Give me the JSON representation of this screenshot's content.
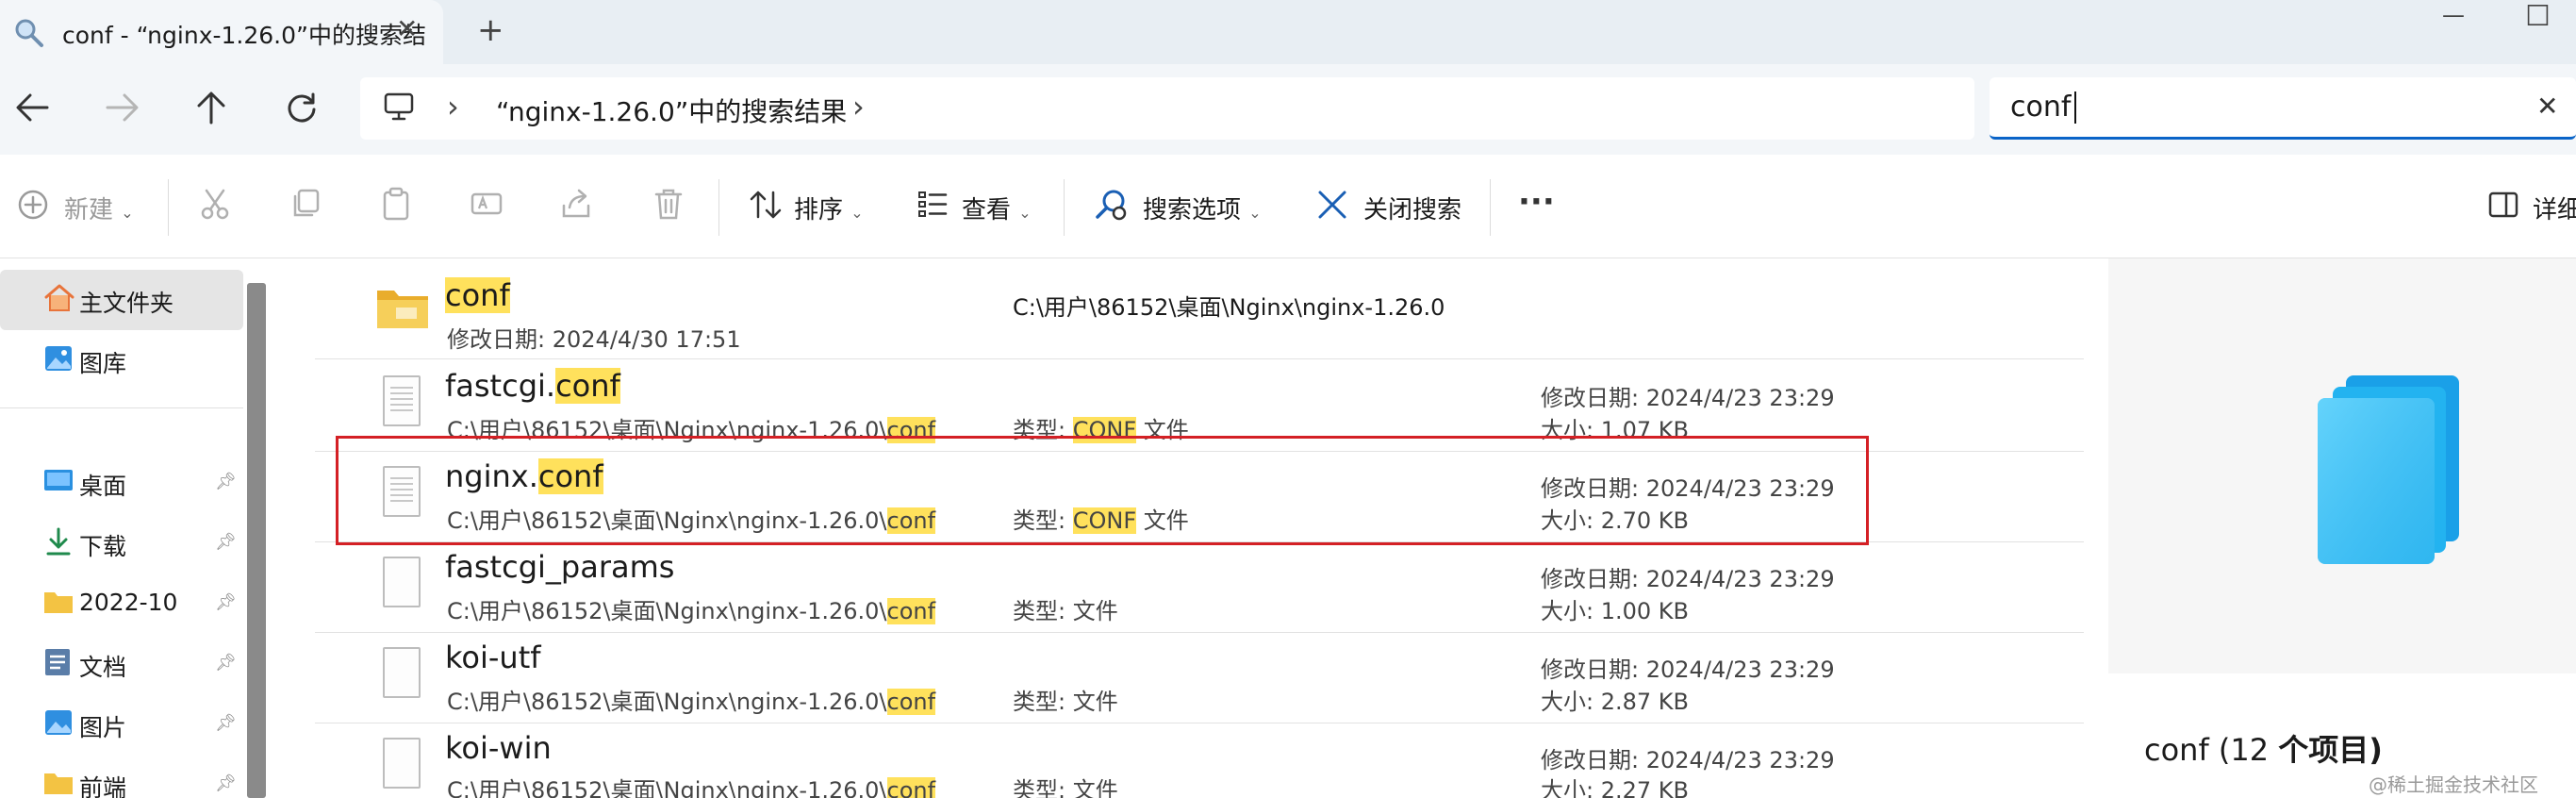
{
  "window": {
    "tab_title": "conf - “nginx-1.26.0”中的搜索结",
    "close_tab": "✕",
    "new_tab": "+",
    "minimize": "—",
    "maximize": "☐"
  },
  "nav": {
    "breadcrumb_sep1": "›",
    "breadcrumb": "“nginx-1.26.0”中的搜索结果",
    "breadcrumb_sep2": "›"
  },
  "search": {
    "value": "conf",
    "clear": "✕"
  },
  "toolbar": {
    "new_label": "新建",
    "sort_label": "排序",
    "view_label": "查看",
    "search_options_label": "搜索选项",
    "close_search_label": "关闭搜索",
    "more_label": "···",
    "details_label": "详细"
  },
  "sidebar": {
    "items": [
      {
        "label": "主文件夹"
      },
      {
        "label": "图库"
      },
      {
        "label": "桌面"
      },
      {
        "label": "下载"
      },
      {
        "label": "2022-10"
      },
      {
        "label": "文档"
      },
      {
        "label": "图片"
      },
      {
        "label": "前端"
      }
    ]
  },
  "files": {
    "f0": {
      "name": "conf",
      "date_label": "修改日期:",
      "date": "2024/4/30 17:51",
      "path": "C:\\用户\\86152\\桌面\\Nginx\\nginx-1.26.0"
    },
    "f1": {
      "name_prefix": "fastcgi.",
      "name_hl": "conf",
      "path_prefix": "C:\\用户\\86152\\桌面\\Nginx\\nginx-1.26.0\\",
      "path_hl": "conf",
      "type_label": "类型:",
      "type_hl": "CONF",
      "type_suffix": " 文件",
      "date_label": "修改日期:",
      "date": "2024/4/23 23:29",
      "size_label": "大小:",
      "size": "1.07 KB"
    },
    "f2": {
      "name_prefix": "nginx.",
      "name_hl": "conf",
      "path_prefix": "C:\\用户\\86152\\桌面\\Nginx\\nginx-1.26.0\\",
      "path_hl": "conf",
      "type_label": "类型:",
      "type_hl": "CONF",
      "type_suffix": " 文件",
      "date_label": "修改日期:",
      "date": "2024/4/23 23:29",
      "size_label": "大小:",
      "size": "2.70 KB"
    },
    "f3": {
      "name": "fastcgi_params",
      "path_prefix": "C:\\用户\\86152\\桌面\\Nginx\\nginx-1.26.0\\",
      "path_hl": "conf",
      "type_label": "类型:",
      "type_value": "文件",
      "date_label": "修改日期:",
      "date": "2024/4/23 23:29",
      "size_label": "大小:",
      "size": "1.00 KB"
    },
    "f4": {
      "name": "koi-utf",
      "path_prefix": "C:\\用户\\86152\\桌面\\Nginx\\nginx-1.26.0\\",
      "path_hl": "conf",
      "type_label": "类型:",
      "type_value": "文件",
      "date_label": "修改日期:",
      "date": "2024/4/23 23:29",
      "size_label": "大小:",
      "size": "2.87 KB"
    },
    "f5": {
      "name": "koi-win",
      "path_prefix": "C:\\用户\\86152\\桌面\\Nginx\\nginx-1.26.0\\",
      "path_hl": "conf",
      "type_label": "类型:",
      "type_value": "文件",
      "date_label": "修改日期:",
      "date": "2024/4/23 23:29",
      "size_label": "大小:",
      "size": "2.27 KB"
    }
  },
  "preview": {
    "title_prefix": "conf (12 ",
    "title_bold": "个项目)",
    "watermark": "@稀土掘金技术社区"
  },
  "colors": {
    "accent": "#0a64c8",
    "highlight": "#ffe15c",
    "annotation_red": "#d42025",
    "folder": "#f3c343"
  }
}
